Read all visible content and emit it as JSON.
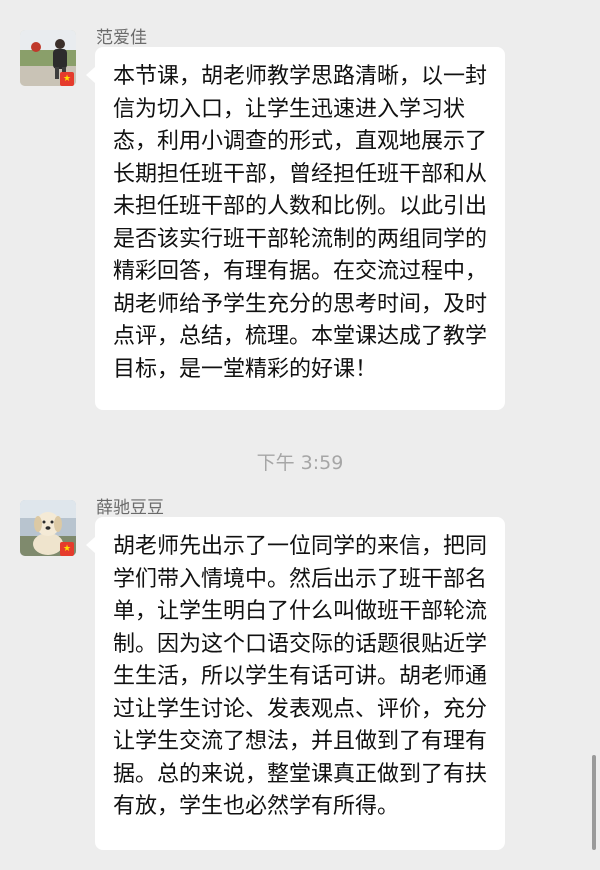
{
  "chat": {
    "messages": [
      {
        "sender": "范爱佳",
        "avatar": "profile-photo-person-with-ball",
        "text": "本节课，胡老师教学思路清晰，以一封信为切入口，让学生迅速进入学习状态，利用小调查的形式，直观地展示了长期担任班干部，曾经担任班干部和从未担任班干部的人数和比例。以此引出是否该实行班干部轮流制的两组同学的精彩回答，有理有据。在交流过程中，胡老师给予学生充分的思考时间，及时点评，总结，梳理。本堂课达成了教学目标，是一堂精彩的好课！"
      },
      {
        "sender": "薛驰豆豆",
        "avatar": "profile-photo-dog",
        "text": "胡老师先出示了一位同学的来信，把同学们带入情境中。然后出示了班干部名单，让学生明白了什么叫做班干部轮流制。因为这个口语交际的话题很贴近学生生活，所以学生有话可讲。胡老师通过让学生讨论、发表观点、评价，充分让学生交流了想法，并且做到了有理有据。总的来说，整堂课真正做到了有扶有放，学生也必然学有所得。"
      }
    ],
    "timestamp": "下午 3:59"
  },
  "colors": {
    "background": "#ededed",
    "bubble": "#ffffff",
    "sender_name": "#6b6b6b",
    "timestamp": "#a6a6a6",
    "flag_badge": "#e53b2c"
  }
}
